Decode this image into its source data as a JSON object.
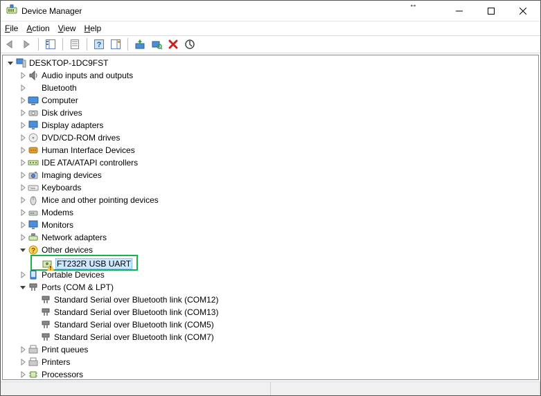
{
  "window": {
    "title": "Device Manager"
  },
  "menu": {
    "file": "File",
    "action": "Action",
    "view": "View",
    "help": "Help"
  },
  "tree": {
    "root": "DESKTOP-1DC9FST",
    "categories": [
      {
        "label": "Audio inputs and outputs",
        "icon": "audio",
        "expanded": false
      },
      {
        "label": "Bluetooth",
        "icon": "bluetooth",
        "expanded": false
      },
      {
        "label": "Computer",
        "icon": "computer",
        "expanded": false
      },
      {
        "label": "Disk drives",
        "icon": "disk",
        "expanded": false
      },
      {
        "label": "Display adapters",
        "icon": "display",
        "expanded": false
      },
      {
        "label": "DVD/CD-ROM drives",
        "icon": "optical",
        "expanded": false
      },
      {
        "label": "Human Interface Devices",
        "icon": "hid",
        "expanded": false
      },
      {
        "label": "IDE ATA/ATAPI controllers",
        "icon": "ide",
        "expanded": false
      },
      {
        "label": "Imaging devices",
        "icon": "imaging",
        "expanded": false
      },
      {
        "label": "Keyboards",
        "icon": "keyboard",
        "expanded": false
      },
      {
        "label": "Mice and other pointing devices",
        "icon": "mouse",
        "expanded": false
      },
      {
        "label": "Modems",
        "icon": "modem",
        "expanded": false
      },
      {
        "label": "Monitors",
        "icon": "monitor",
        "expanded": false
      },
      {
        "label": "Network adapters",
        "icon": "network",
        "expanded": false
      },
      {
        "label": "Other devices",
        "icon": "other",
        "expanded": true,
        "children": [
          {
            "label": "FT232R USB UART",
            "icon": "unknown",
            "warn": true,
            "selected": true,
            "highlighted": true
          }
        ]
      },
      {
        "label": "Portable Devices",
        "icon": "portable",
        "expanded": false
      },
      {
        "label": "Ports (COM & LPT)",
        "icon": "port",
        "expanded": true,
        "children": [
          {
            "label": "Standard Serial over Bluetooth link (COM12)",
            "icon": "port"
          },
          {
            "label": "Standard Serial over Bluetooth link (COM13)",
            "icon": "port"
          },
          {
            "label": "Standard Serial over Bluetooth link (COM5)",
            "icon": "port"
          },
          {
            "label": "Standard Serial over Bluetooth link (COM7)",
            "icon": "port"
          }
        ]
      },
      {
        "label": "Print queues",
        "icon": "printqueue",
        "expanded": false
      },
      {
        "label": "Printers",
        "icon": "printer",
        "expanded": false
      },
      {
        "label": "Processors",
        "icon": "cpu",
        "expanded": false
      }
    ]
  }
}
